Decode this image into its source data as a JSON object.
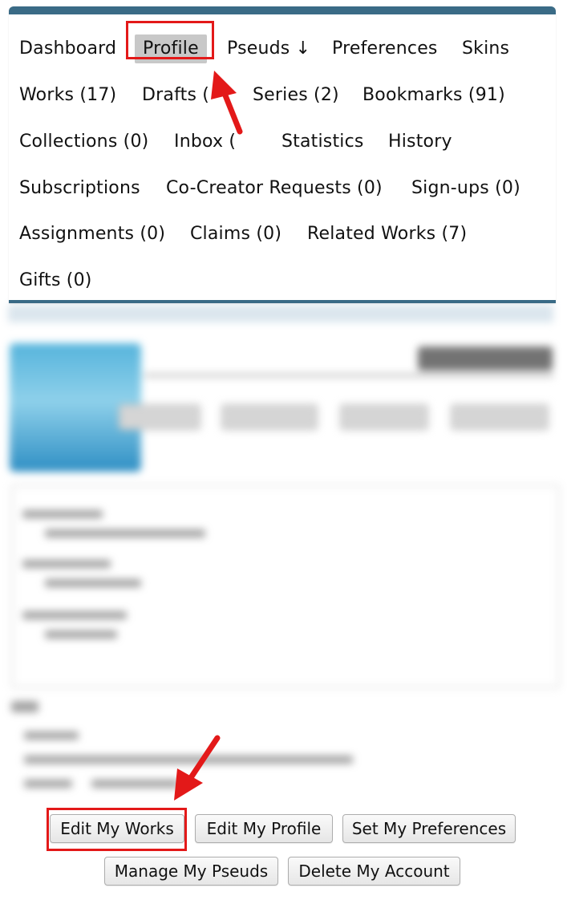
{
  "nav": {
    "rows": [
      [
        "Dashboard",
        "Profile",
        "Pseuds ↓",
        "Preferences",
        "Skins"
      ],
      [
        "Works (17)",
        "Drafts (",
        "Series (2)",
        "Bookmarks (91)"
      ],
      [
        "Collections (0)",
        "Inbox (",
        "Statistics",
        "History"
      ],
      [
        "Subscriptions",
        "Co-Creator Requests (0)",
        "Sign-ups (0)"
      ],
      [
        "Assignments (0)",
        "Claims (0)",
        "Related Works (7)"
      ],
      [
        "Gifts (0)"
      ]
    ],
    "current": "Profile",
    "accent_color": "#3a6b86"
  },
  "annotations": {
    "highlight_color": "#e31919",
    "highlighted": [
      "Profile",
      "Edit My Works"
    ]
  },
  "buttons": {
    "edit_works": "Edit My Works",
    "edit_profile": "Edit My Profile",
    "set_preferences": "Set My Preferences",
    "manage_pseuds": "Manage My Pseuds",
    "delete_account": "Delete My Account"
  }
}
